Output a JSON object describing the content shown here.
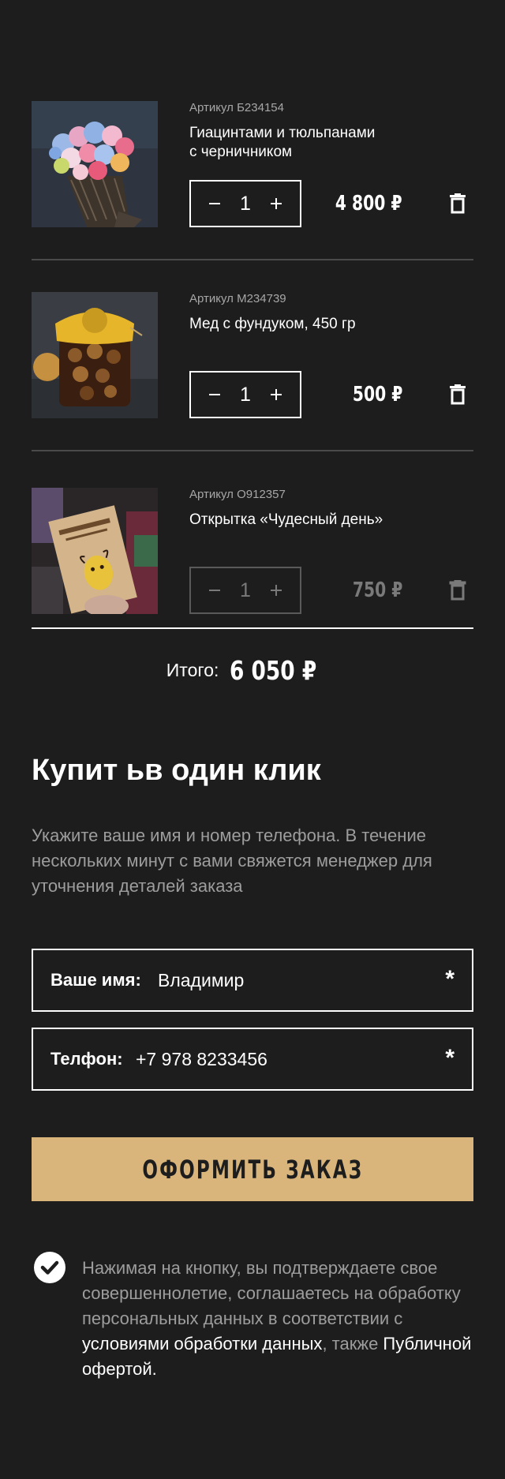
{
  "cart": {
    "items": [
      {
        "sku": "Артикул Б234154",
        "name_line1": "Гиацинтами и тюльпанами",
        "name_line2": "с черничником",
        "qty": "1",
        "price": "4 800 ₽"
      },
      {
        "sku": "Артикул М234739",
        "name_line1": "Мед с фундуком, 450 гр",
        "name_line2": "",
        "qty": "1",
        "price": "500 ₽"
      },
      {
        "sku": "Артикул О912357",
        "name_line1": "Открытка «Чудесный день»",
        "name_line2": "",
        "qty": "1",
        "price": "750 ₽"
      }
    ]
  },
  "total": {
    "label": "Итого:",
    "value": "6 050 ₽"
  },
  "one_click": {
    "title": "Купит ьв один клик",
    "description": "Укажите ваше имя и номер телефона. В течение нескольких минут с вами свяжется менеджер для уточнения деталей заказа"
  },
  "form": {
    "name_label": "Ваше имя:",
    "name_value": "Владимир",
    "phone_label": "Телфон:",
    "phone_value": "+7 978 8233456",
    "required_mark": "*",
    "submit_label": "ОФОРМИТЬ ЗАКАЗ"
  },
  "consent": {
    "text_part1": "Нажимая на кнопку, вы подтверждаете свое совершеннолетие, соглашаетесь на обработку персональных данных в соответствии с ",
    "link1": "условиями обработки данных",
    "text_part2": ", также ",
    "link2": "Публичной офертой."
  },
  "colors": {
    "background": "#1d1d1d",
    "accent": "#d9b57c",
    "muted_text": "#9d9d9d"
  },
  "icons": {
    "minus": "minus-icon",
    "plus": "plus-icon",
    "trash": "trash-icon",
    "check": "check-circle-icon"
  }
}
